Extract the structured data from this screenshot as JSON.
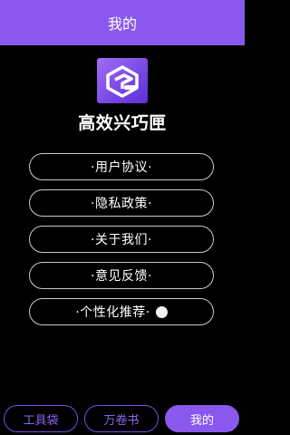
{
  "header": {
    "title": "我的"
  },
  "app": {
    "name": "高效兴巧匣",
    "logo_icon": "app-logo-icon"
  },
  "menu": [
    {
      "label": "·用户协议·"
    },
    {
      "label": "·隐私政策·"
    },
    {
      "label": "·关于我们·"
    },
    {
      "label": "·意见反馈·"
    },
    {
      "label": "·个性化推荐·",
      "toggle_on": false
    }
  ],
  "tabs": [
    {
      "label": "工具袋",
      "active": false
    },
    {
      "label": "万卷书",
      "active": false
    },
    {
      "label": "我的",
      "active": true
    }
  ],
  "colors": {
    "accent": "#8b58ee",
    "background": "#000000"
  }
}
